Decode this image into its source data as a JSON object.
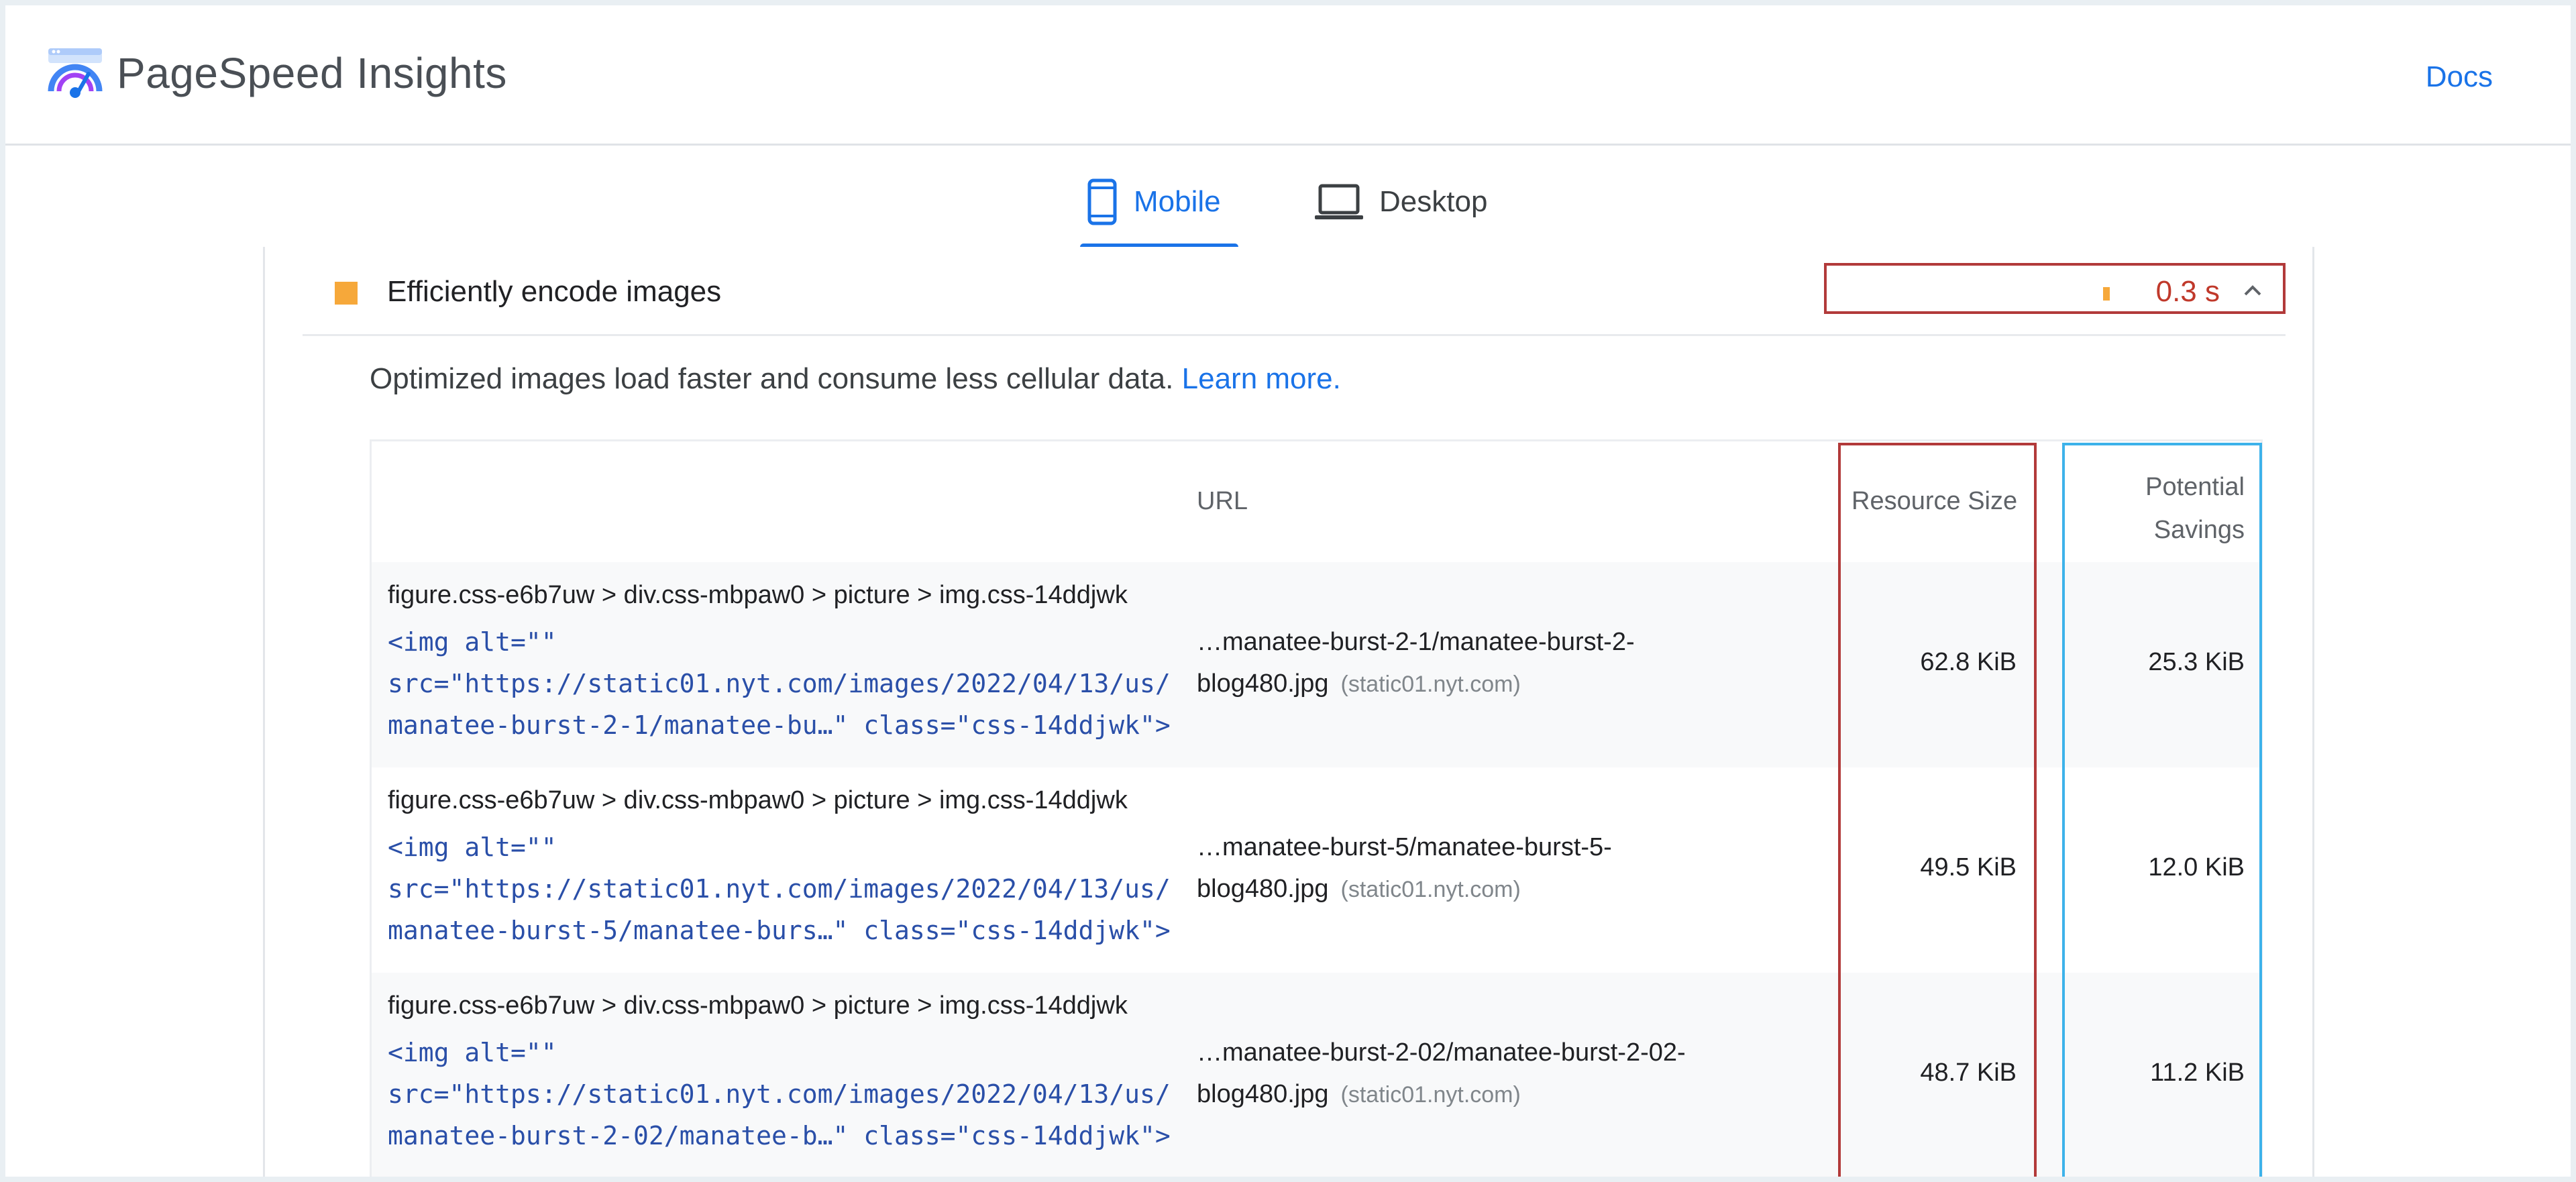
{
  "header": {
    "title": "PageSpeed Insights",
    "docs_label": "Docs"
  },
  "tabs": [
    {
      "label": "Mobile",
      "icon": "smartphone-icon",
      "active": true
    },
    {
      "label": "Desktop",
      "icon": "laptop-icon",
      "active": false
    }
  ],
  "audit": {
    "title": "Efficiently encode images",
    "metric_value": "0.3 s",
    "description": "Optimized images load faster and consume less cellular data.",
    "learn_more": "Learn more."
  },
  "table": {
    "headers": {
      "url": "URL",
      "resource_size": "Resource Size",
      "potential_savings_line1": "Potential",
      "potential_savings_line2": "Savings"
    },
    "rows": [
      {
        "node_path": "figure.css-e6b7uw > div.css-mbpaw0 > picture > img.css-14ddjwk",
        "code_line1": "<img alt=\"\"",
        "code_line2": "src=\"https://static01.nyt.com/images/2022/04/13/us/",
        "code_line3": "manatee-burst-2-1/manatee-bu…\" class=\"css-14ddjwk\">",
        "url_line1": "…manatee-burst-2-1/manatee-burst-2-",
        "url_line2": "blog480.jpg",
        "url_host": "(static01.nyt.com)",
        "resource_size": "62.8 KiB",
        "potential_savings": "25.3 KiB"
      },
      {
        "node_path": "figure.css-e6b7uw > div.css-mbpaw0 > picture > img.css-14ddjwk",
        "code_line1": "<img alt=\"\"",
        "code_line2": "src=\"https://static01.nyt.com/images/2022/04/13/us/",
        "code_line3": "manatee-burst-5/manatee-burs…\" class=\"css-14ddjwk\">",
        "url_line1": "…manatee-burst-5/manatee-burst-5-",
        "url_line2": "blog480.jpg",
        "url_host": "(static01.nyt.com)",
        "resource_size": "49.5 KiB",
        "potential_savings": "12.0 KiB"
      },
      {
        "node_path": "figure.css-e6b7uw > div.css-mbpaw0 > picture > img.css-14ddjwk",
        "code_line1": "<img alt=\"\"",
        "code_line2": "src=\"https://static01.nyt.com/images/2022/04/13/us/",
        "code_line3": "manatee-burst-2-02/manatee-b…\" class=\"css-14ddjwk\">",
        "url_line1": "…manatee-burst-2-02/manatee-burst-2-02-",
        "url_line2": "blog480.jpg",
        "url_host": "(static01.nyt.com)",
        "resource_size": "48.7 KiB",
        "potential_savings": "11.2 KiB"
      }
    ]
  },
  "colors": {
    "brand_blue": "#1a73e8",
    "audit_warning": "#f6a83a",
    "metric_red": "#c0392b",
    "highlight_red": "#b23a3a",
    "highlight_blue": "#3db2ea"
  }
}
